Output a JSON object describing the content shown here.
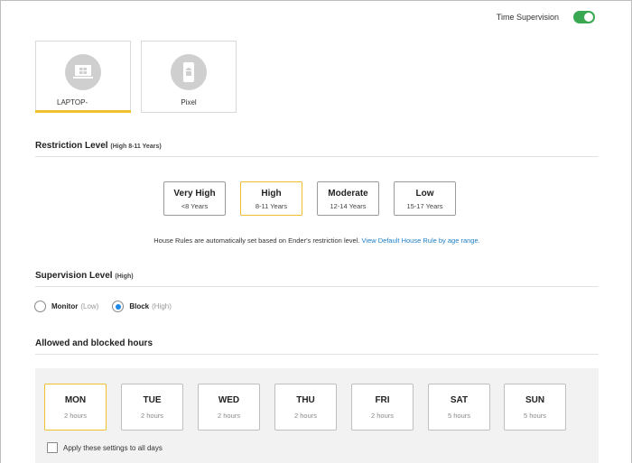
{
  "header": {
    "time_supervision_label": "Time Supervision",
    "time_supervision_on": true
  },
  "devices": [
    {
      "name": "LAPTOP-",
      "icon": "windows-laptop-icon",
      "selected": true
    },
    {
      "name": "Pixel",
      "icon": "android-phone-icon",
      "selected": false
    }
  ],
  "restriction": {
    "title": "Restriction Level",
    "subtitle": "(High 8-11 Years)",
    "levels": [
      {
        "label": "Very High",
        "range": "<8 Years"
      },
      {
        "label": "High",
        "range": "8-11 Years"
      },
      {
        "label": "Moderate",
        "range": "12-14 Years"
      },
      {
        "label": "Low",
        "range": "15-17 Years"
      }
    ],
    "selected": "High",
    "note": "House Rules are automatically set based on Ender's restriction level.",
    "note_link": "View Default House Rule by age range."
  },
  "supervision": {
    "title": "Supervision Level",
    "subtitle": "(High)",
    "options": [
      {
        "label": "Monitor",
        "hint": "(Low)",
        "selected": false
      },
      {
        "label": "Block",
        "hint": "(High)",
        "selected": true
      }
    ]
  },
  "hours": {
    "title": "Allowed and blocked hours",
    "days": [
      {
        "day": "MON",
        "hours": "2 hours"
      },
      {
        "day": "TUE",
        "hours": "2 hours"
      },
      {
        "day": "WED",
        "hours": "2 hours"
      },
      {
        "day": "THU",
        "hours": "2 hours"
      },
      {
        "day": "FRI",
        "hours": "2 hours"
      },
      {
        "day": "SAT",
        "hours": "5 hours"
      },
      {
        "day": "SUN",
        "hours": "5 hours"
      }
    ],
    "selected_day": "MON",
    "apply_all_label": "Apply these settings to all days",
    "apply_all_checked": false
  },
  "colors": {
    "accent": "#f0c030",
    "toggle_on": "#3aa852",
    "link": "#1e7fc6",
    "radio": "#1e88e5"
  }
}
